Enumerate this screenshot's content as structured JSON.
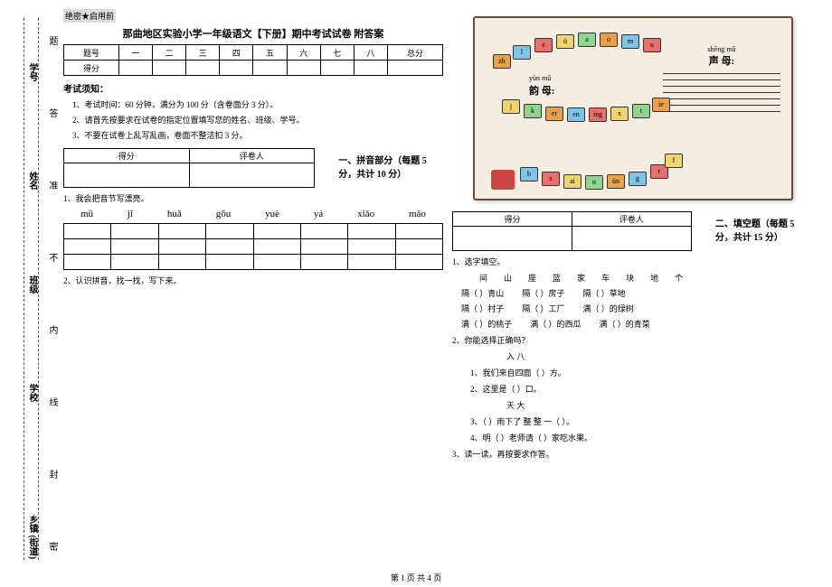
{
  "gutter": {
    "labels": [
      "乡镇 (街道)",
      "学校",
      "班级",
      "姓名",
      "学号"
    ],
    "margin_text": [
      "密",
      "封",
      "线",
      "内",
      "不",
      "准",
      "答",
      "题"
    ]
  },
  "header": {
    "secret": "绝密★启用前",
    "title": "那曲地区实验小学一年级语文【下册】期中考试试卷 附答案"
  },
  "score_table": {
    "row1_label": "题号",
    "cols": [
      "一",
      "二",
      "三",
      "四",
      "五",
      "六",
      "七",
      "八",
      "总分"
    ],
    "row2_label": "得分"
  },
  "exam_notes": {
    "heading": "考试须知：",
    "items": [
      "1、考试时间：60 分钟，满分为 100 分（含卷面分 3 分）。",
      "2、请首先按要求在试卷的指定位置填写您的姓名、班级、学号。",
      "3、不要在试卷上乱写乱画，卷面不整洁扣 3 分。"
    ]
  },
  "score_cell": {
    "h1": "得分",
    "h2": "评卷人"
  },
  "section1": {
    "title": "一、拼音部分（每题 5 分，共计 10 分）",
    "q1": "1、我会把音节写漂亮。",
    "pinyins": [
      "mǔ",
      "jǐ",
      "huǎ",
      "gǒu",
      "yuè",
      "yá",
      "xiǎo",
      "māo"
    ],
    "q2": "2、认识拼音，找一找，写下来。"
  },
  "illustration": {
    "shengmu_pinyin": "shēng mǔ",
    "shengmu": "声 母:",
    "yunmu_pinyin": "yùn mǔ",
    "yunmu": "韵 母:",
    "blocks_top": [
      "zh",
      "l",
      "e",
      "ü",
      "a",
      "o",
      "m",
      "u"
    ],
    "blocks_mid": [
      "j",
      "k",
      "er",
      "en",
      "ing",
      "x",
      "t",
      "ie"
    ],
    "blocks_bot": [
      "b",
      "s",
      "ai",
      "n",
      "ün",
      "g",
      "r",
      "f"
    ]
  },
  "section2": {
    "title": "二、填空题（每题 5 分，共计 15 分）",
    "q1": "1、选字填空。",
    "word_bank": [
      "间",
      "山",
      "座",
      "篮",
      "家",
      "车",
      "块",
      "地",
      "个"
    ],
    "rows": [
      [
        "隔（        ）青山",
        "隔（        ）房子",
        "隔（        ）草地"
      ],
      [
        "隔（        ）村子",
        "隔（        ）工厂",
        "满（        ）的绿树"
      ],
      [
        "满（        ）的桃子",
        "满（        ）的西瓜",
        "满（        ）的青菜"
      ]
    ],
    "q2": "2、你能选择正确吗？",
    "pair1": "入        八",
    "i1": "1、我们来自四面（        ）方。",
    "i2": "2、这里是（        ）口。",
    "pair2": "天        大",
    "i3": "3、（        ）雨下了 整 整 一（        ）。",
    "i4": "4、明（        ）老师请（        ）家吃水果。",
    "q3": "3、读一读，再按要求作答。"
  },
  "footer": "第 1 页 共 4 页"
}
